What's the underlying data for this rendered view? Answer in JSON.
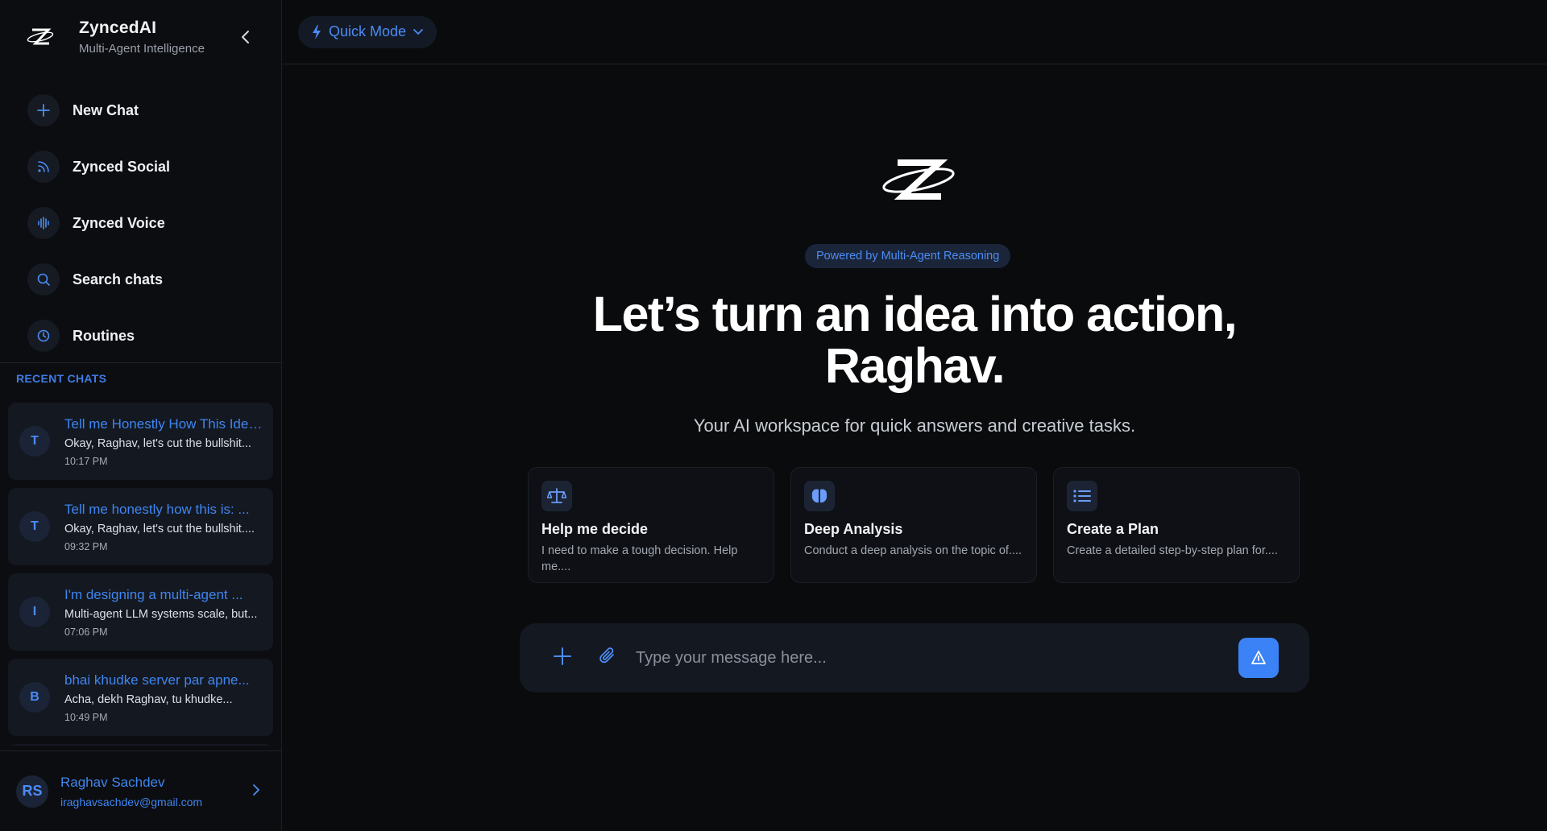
{
  "brand": {
    "name": "ZyncedAI",
    "subtitle": "Multi-Agent Intelligence"
  },
  "nav": {
    "items": [
      {
        "label": "New Chat",
        "icon": "plus-icon"
      },
      {
        "label": "Zynced Social",
        "icon": "rss-icon"
      },
      {
        "label": "Zynced Voice",
        "icon": "voice-wave-icon"
      },
      {
        "label": "Search chats",
        "icon": "search-icon"
      },
      {
        "label": "Routines",
        "icon": "clock-icon"
      }
    ]
  },
  "recent": {
    "title": "RECENT CHATS",
    "chats": [
      {
        "initial": "T",
        "title": "Tell me Honestly How This Idea...",
        "preview": "Okay, Raghav, let's cut the bullshit...",
        "time": "10:17 PM"
      },
      {
        "initial": "T",
        "title": "Tell me honestly how this is: ...",
        "preview": "Okay, Raghav, let's cut the bullshit....",
        "time": "09:32 PM"
      },
      {
        "initial": "I",
        "title": "I'm designing a multi-agent ...",
        "preview": "Multi-agent LLM systems scale, but...",
        "time": "07:06 PM"
      },
      {
        "initial": "B",
        "title": "bhai khudke server par apne...",
        "preview": "Acha, dekh Raghav, tu khudke...",
        "time": "10:49 PM"
      }
    ]
  },
  "user": {
    "initials": "RS",
    "name": "Raghav Sachdev",
    "email": "iraghavsachdev@gmail.com"
  },
  "topbar": {
    "mode_label": "Quick Mode"
  },
  "hero": {
    "badge": "Powered by Multi-Agent Reasoning",
    "headline_line1": "Let’s turn an idea into action,",
    "headline_line2": "Raghav.",
    "subline": "Your AI workspace for quick answers and creative tasks."
  },
  "cards": [
    {
      "icon": "scale-icon",
      "title": "Help me decide",
      "desc": "I need to make a tough decision. Help me...."
    },
    {
      "icon": "brain-icon",
      "title": "Deep Analysis",
      "desc": "Conduct a deep analysis on the topic of...."
    },
    {
      "icon": "list-icon",
      "title": "Create a Plan",
      "desc": "Create a detailed step-by-step plan for...."
    }
  ],
  "composer": {
    "placeholder": "Type your message here..."
  },
  "colors": {
    "accent": "#3b82f6",
    "link": "#3f86f0",
    "background": "#0a0b0d",
    "sidebar": "#0c0d10"
  }
}
